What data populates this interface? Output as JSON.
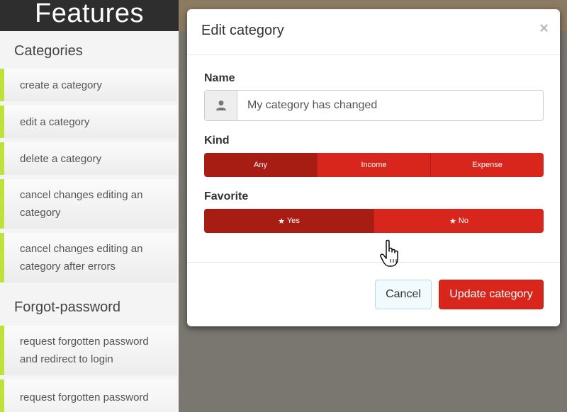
{
  "sidebar": {
    "header": "Features",
    "sections": [
      {
        "title": "Categories"
      },
      {
        "title": "Forgot-password"
      }
    ],
    "items": [
      {
        "label": "create a category"
      },
      {
        "label": "edit a category"
      },
      {
        "label": "delete a category"
      },
      {
        "label": "cancel changes editing an category"
      },
      {
        "label": "cancel changes editing an category after errors"
      },
      {
        "label": "request forgotten password and redirect to login"
      },
      {
        "label": "request forgotten password"
      }
    ]
  },
  "modal": {
    "title": "Edit category",
    "close": "×",
    "name_label": "Name",
    "name_value": "My category has changed",
    "kind_label": "Kind",
    "kind_options": [
      "Any",
      "Income",
      "Expense"
    ],
    "kind_selected": "Any",
    "favorite_label": "Favorite",
    "favorite_options": [
      "Yes",
      "No"
    ],
    "favorite_selected": "Yes",
    "cancel_label": "Cancel",
    "update_label": "Update category"
  },
  "colors": {
    "accent": "#d9261c",
    "accent_active": "#a81d13",
    "sidebar_marker": "#bde33b"
  }
}
